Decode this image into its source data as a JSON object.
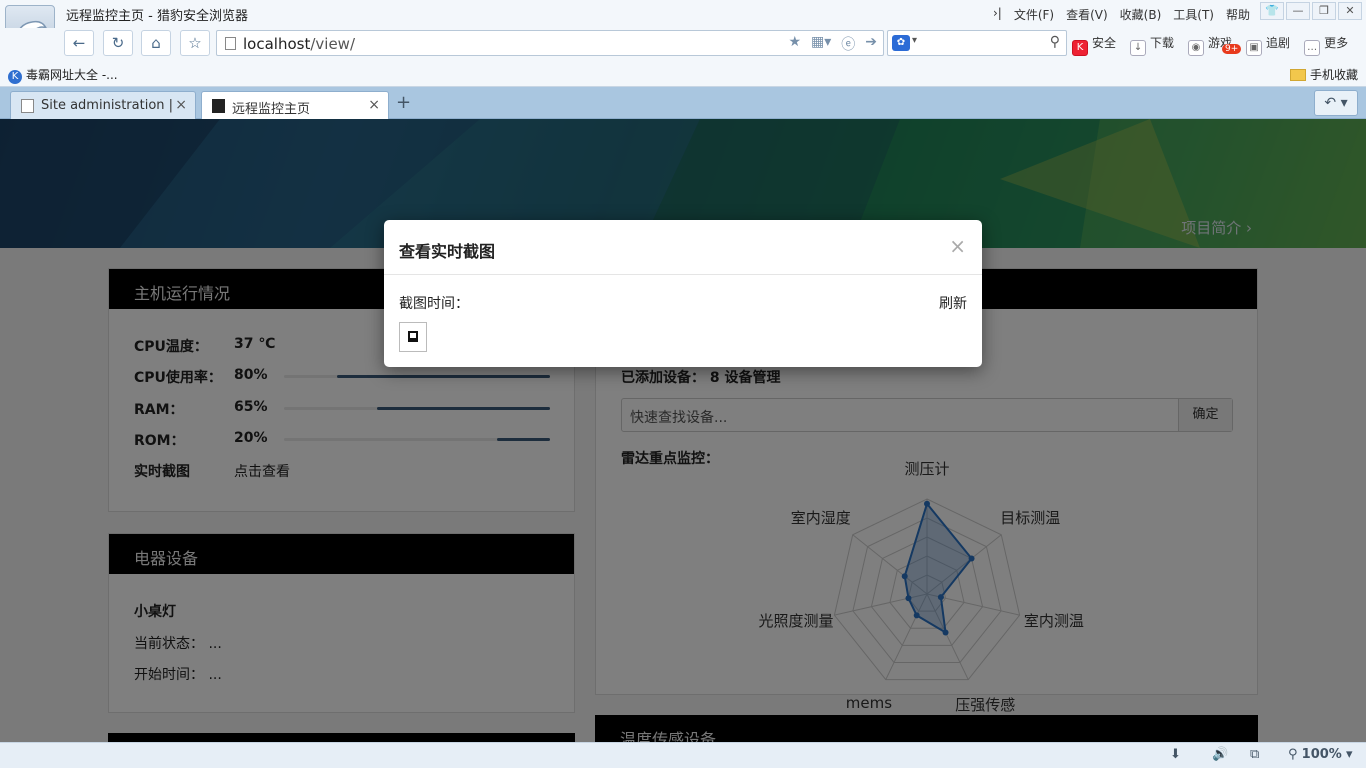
{
  "browser": {
    "window_title": "远程监控主页 - 猎豹安全浏览器",
    "menu": [
      "文件(F)",
      "查看(V)",
      "收藏(B)",
      "工具(T)",
      "帮助"
    ],
    "url_host": "localhost",
    "url_path": "/view/",
    "toolbar": {
      "security": "安全",
      "download": "下载",
      "games": "游戏",
      "games_badge": "9+",
      "follow": "追剧",
      "more": "更多"
    },
    "bookmarks": {
      "left": "毒霸网址大全 -...",
      "right": "手机收藏"
    },
    "tabs": [
      {
        "label": "Site administration | ..."
      },
      {
        "label": "远程监控主页"
      }
    ],
    "zoom": "100%"
  },
  "page": {
    "intro_link": "项目简介",
    "host_panel": {
      "title": "主机运行情况",
      "cpu_temp_label": "CPU温度：",
      "cpu_temp_value": "37 ℃",
      "cpu_usage_label": "CPU使用率：",
      "cpu_usage_value": "80%",
      "cpu_usage_fraction": 0.8,
      "ram_label": "RAM：",
      "ram_value": "65%",
      "ram_fraction": 0.65,
      "rom_label": "ROM：",
      "rom_value": "20%",
      "rom_fraction": 0.2,
      "screenshot_label": "实时截图",
      "screenshot_link": "点击查看"
    },
    "appliance_panel": {
      "title": "电器设备",
      "device_name": "小桌灯",
      "status_label": "当前状态：",
      "status_value": "...",
      "start_label": "开始时间：",
      "start_value": "..."
    },
    "device_panel": {
      "added_label": "已添加设备：",
      "added_count": "8",
      "manage_link": "设备管理",
      "search_placeholder": "快速查找设备...",
      "confirm": "确定",
      "radar_title": "雷达重点监控："
    },
    "temp_panel": {
      "title": "温度传感设备"
    }
  },
  "modal": {
    "title": "查看实时截图",
    "time_label": "截图时间：",
    "refresh": "刷新",
    "close": "×"
  },
  "chart_data": {
    "type": "radar",
    "indicators": [
      "测压计",
      "目标测温",
      "室内测温",
      "压强传感",
      "mems",
      "光照度测量",
      "室内湿度"
    ],
    "series": [
      {
        "values": [
          95,
          60,
          15,
          45,
          25,
          20,
          30
        ]
      }
    ],
    "range": [
      0,
      100
    ]
  }
}
